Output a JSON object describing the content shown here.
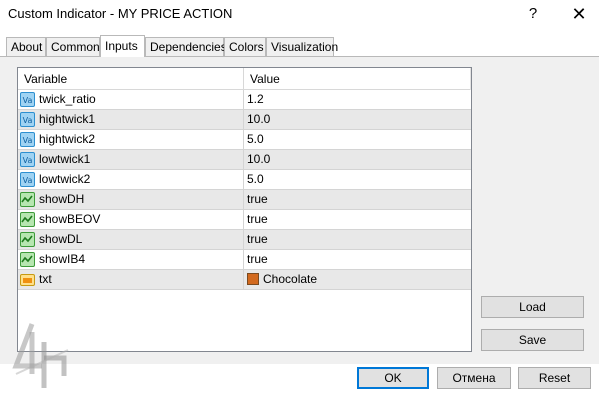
{
  "window": {
    "title": "Custom Indicator - MY PRICE ACTION",
    "help_label": "?",
    "close_label": "✕"
  },
  "tabs": [
    {
      "label": "About"
    },
    {
      "label": "Common"
    },
    {
      "label": "Inputs"
    },
    {
      "label": "Dependencies"
    },
    {
      "label": "Colors"
    },
    {
      "label": "Visualization"
    }
  ],
  "active_tab": "Inputs",
  "grid": {
    "header_variable": "Variable",
    "header_value": "Value",
    "rows": [
      {
        "icon": "value-icon",
        "variable": "twick_ratio",
        "value": "1.2"
      },
      {
        "icon": "value-icon",
        "variable": "hightwick1",
        "value": "10.0"
      },
      {
        "icon": "value-icon",
        "variable": "hightwick2",
        "value": "5.0"
      },
      {
        "icon": "value-icon",
        "variable": "lowtwick1",
        "value": "10.0"
      },
      {
        "icon": "value-icon",
        "variable": "lowtwick2",
        "value": "5.0"
      },
      {
        "icon": "bool-icon",
        "variable": "showDH",
        "value": "true"
      },
      {
        "icon": "bool-icon",
        "variable": "showBEOV",
        "value": "true"
      },
      {
        "icon": "bool-icon",
        "variable": "showDL",
        "value": "true"
      },
      {
        "icon": "bool-icon",
        "variable": "showIB4",
        "value": "true"
      },
      {
        "icon": "color-icon",
        "variable": "txt",
        "value": "Chocolate",
        "swatch": "#d2691e"
      }
    ]
  },
  "buttons": {
    "load": "Load",
    "save": "Save",
    "ok": "OK",
    "cancel": "Отмена",
    "reset": "Reset"
  },
  "colors": {
    "panel_bg": "#f0f0f0",
    "alt_row": "#e8e8e8",
    "accent": "#0078d7",
    "chocolate": "#d2691e"
  }
}
